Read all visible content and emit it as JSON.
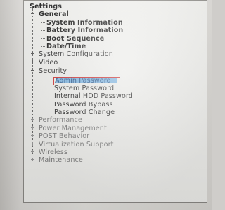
{
  "window": {
    "title": "Settings"
  },
  "tree": {
    "general": {
      "label": "General",
      "children": [
        "System Information",
        "Battery Information",
        "Boot Sequence",
        "Date/Time"
      ]
    },
    "system_configuration": "System Configuration",
    "video": "Video",
    "security": {
      "label": "Security",
      "children": [
        "Admin Password",
        "System Password",
        "Internal HDD Password",
        "Password Bypass",
        "Password Change"
      ]
    },
    "collapsed": [
      "Performance",
      "Power Management",
      "POST Behavior",
      "Virtualization Support",
      "Wireless",
      "Maintenance"
    ]
  },
  "selected_item": "Admin Password",
  "colors": {
    "selection_outline": "#d12a2a",
    "selection_fill": "#7fb8e6"
  }
}
